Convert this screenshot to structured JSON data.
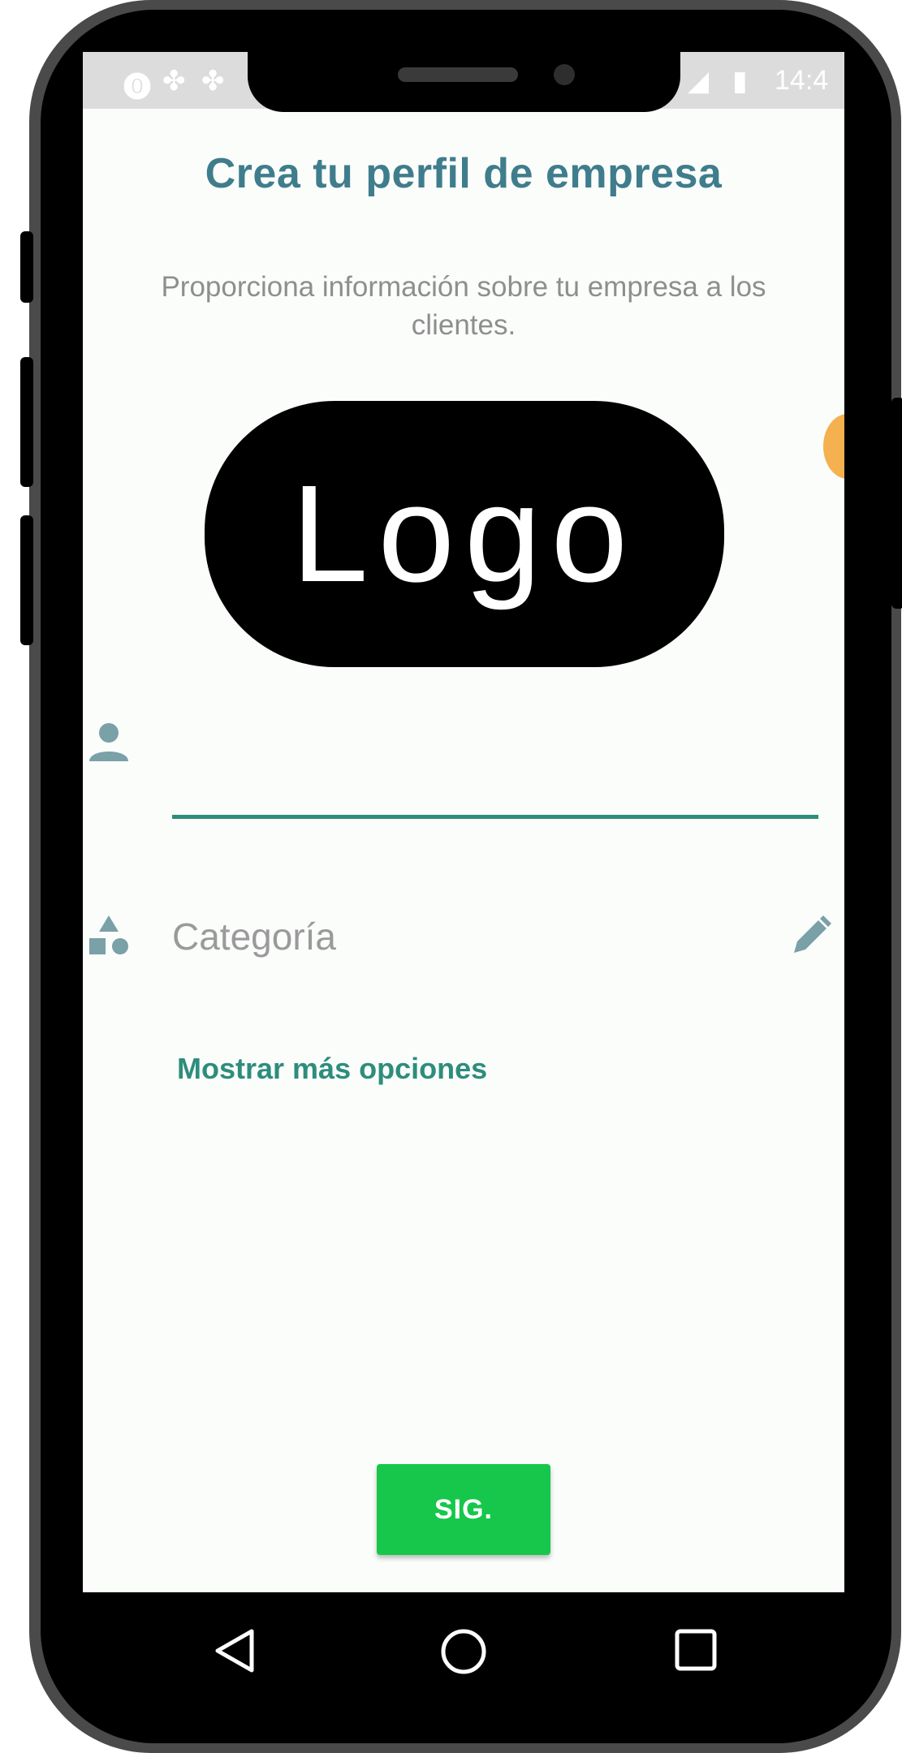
{
  "statusbar": {
    "time": "14:4",
    "left_icons": [
      "pinterest-icon",
      "app-icon",
      "app-icon"
    ],
    "right_icons": [
      "signal-icon",
      "battery-icon"
    ]
  },
  "header": {
    "title": "Crea tu perfil de empresa",
    "subtitle": "Proporciona información sobre tu empresa a los clientes."
  },
  "logo": {
    "text": "Logo"
  },
  "form": {
    "name_value": "",
    "category_label": "Categoría"
  },
  "links": {
    "more_options": "Mostrar más opciones"
  },
  "actions": {
    "next_label": "SIG."
  },
  "navigation": {
    "buttons": [
      "back-icon",
      "home-icon",
      "recents-icon"
    ]
  },
  "colors": {
    "title": "#3f7d8c",
    "accent": "#2e8d7c",
    "button": "#16c74b",
    "screen_bg": "#fbfdfb"
  }
}
